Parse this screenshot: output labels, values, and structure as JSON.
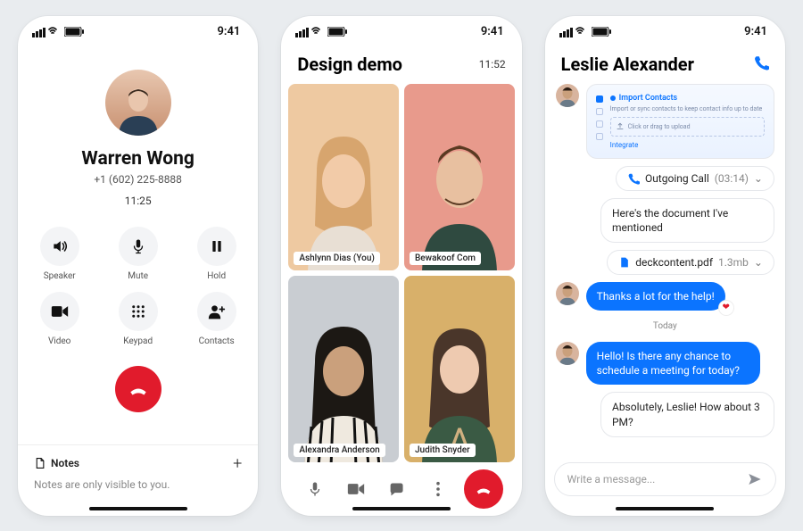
{
  "status": {
    "time": "9:41"
  },
  "phone1": {
    "name": "Warren Wong",
    "number": "+1 (602) 225-8888",
    "timer": "11:25",
    "controls": {
      "speaker": "Speaker",
      "mute": "Mute",
      "hold": "Hold",
      "video": "Video",
      "keypad": "Keypad",
      "contacts": "Contacts"
    },
    "notes": {
      "label": "Notes",
      "hint": "Notes are only visible to you."
    }
  },
  "phone2": {
    "title": "Design demo",
    "timer": "11:52",
    "tiles": [
      {
        "name": "Ashlynn Dias (You)"
      },
      {
        "name": "Bewakoof Com"
      },
      {
        "name": "Alexandra Anderson"
      },
      {
        "name": "Judith Snyder"
      }
    ]
  },
  "phone3": {
    "title": "Leslie Alexander",
    "card": {
      "import": "Import Contacts",
      "sub": "Import or sync contacts to keep contact info up to date",
      "upload": "Click or drag to upload",
      "integrate": "Integrate"
    },
    "call_chip": {
      "label": "Outgoing Call",
      "duration": "(03:14)"
    },
    "msg1": "Here's the document I've mentioned",
    "file_chip": {
      "name": "deckcontent.pdf",
      "size": "1.3mb"
    },
    "msg2": "Thanks a lot for the help!",
    "day": "Today",
    "msg3": "Hello! Is there any chance to schedule a meeting for today?",
    "msg4": "Absolutely, Leslie! How about 3 PM?",
    "composer_placeholder": "Write a message..."
  }
}
